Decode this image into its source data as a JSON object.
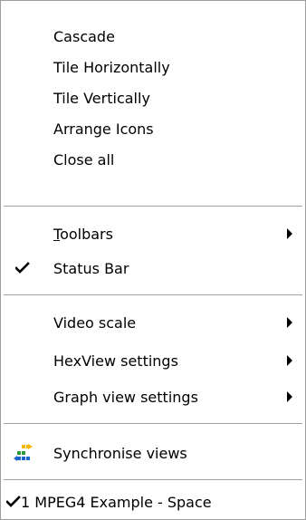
{
  "menu": {
    "items": [
      {
        "label": "Cascade"
      },
      {
        "label": "Tile Horizontally"
      },
      {
        "label": "Tile Vertically"
      },
      {
        "label": "Arrange Icons"
      },
      {
        "label": "Close all"
      },
      {
        "label_underlined": "T",
        "label_rest": "oolbars",
        "submenu": true
      },
      {
        "label": "Status Bar",
        "checked": true
      },
      {
        "label": "Video scale",
        "submenu": true
      },
      {
        "label": "HexView settings",
        "submenu": true
      },
      {
        "label": "Graph view settings",
        "submenu": true
      },
      {
        "label": "Synchronise views",
        "icon": "synchronise-icon"
      },
      {
        "label": "1 MPEG4 Example - Space",
        "checked": true
      }
    ]
  },
  "colors": {
    "menu_background": "#ffffff",
    "separator": "#a0a0a0",
    "text": "#000000",
    "icon_yellow": "#f5b800",
    "icon_blue": "#1a66cc",
    "icon_green": "#2e9a3a"
  }
}
